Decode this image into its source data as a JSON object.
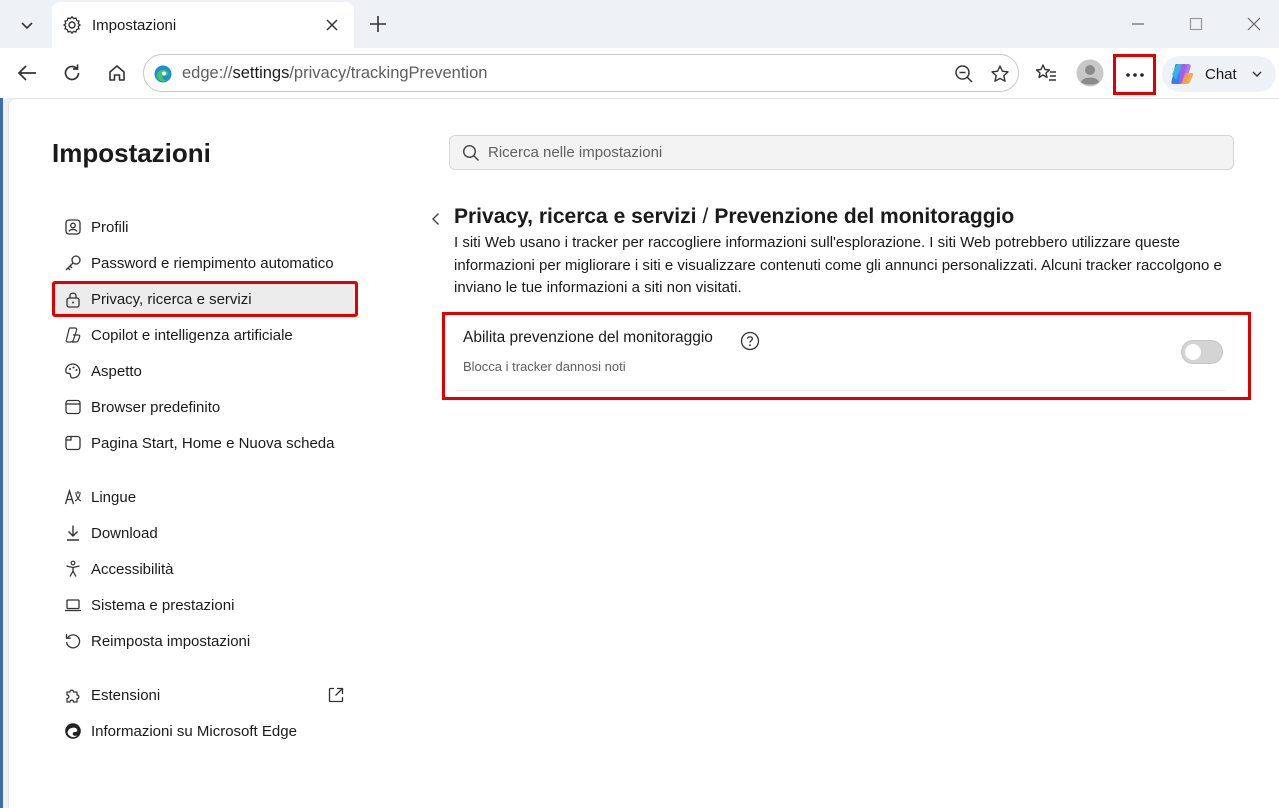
{
  "browser": {
    "tab_title": "Impostazioni",
    "url_prefix": "edge://",
    "url_host": "settings",
    "url_path": "/privacy/trackingPrevention",
    "chat_label": "Chat"
  },
  "settings": {
    "title": "Impostazioni",
    "search_placeholder": "Ricerca nelle impostazioni",
    "nav": [
      {
        "label": "Profili",
        "icon": "profile-icon"
      },
      {
        "label": "Password e riempimento automatico",
        "icon": "key-icon"
      },
      {
        "label": "Privacy, ricerca e servizi",
        "icon": "lock-icon",
        "active": true
      },
      {
        "label": "Copilot e intelligenza artificiale",
        "icon": "copilot-icon"
      },
      {
        "label": "Aspetto",
        "icon": "palette-icon"
      },
      {
        "label": "Browser predefinito",
        "icon": "browser-icon"
      },
      {
        "label": "Pagina Start, Home e Nuova scheda",
        "icon": "newtab-icon"
      },
      {
        "label": "Lingue",
        "icon": "language-icon"
      },
      {
        "label": "Download",
        "icon": "download-icon"
      },
      {
        "label": "Accessibilità",
        "icon": "accessibility-icon"
      },
      {
        "label": "Sistema e prestazioni",
        "icon": "laptop-icon"
      },
      {
        "label": "Reimposta impostazioni",
        "icon": "reset-icon"
      },
      {
        "label": "Estensioni",
        "icon": "puzzle-icon"
      },
      {
        "label": "Informazioni su Microsoft Edge",
        "icon": "edge-icon"
      }
    ]
  },
  "page": {
    "breadcrumb_parent": "Privacy, ricerca e servizi",
    "breadcrumb_separator": "/",
    "breadcrumb_current": "Prevenzione del monitoraggio",
    "description": "I siti Web usano i tracker per raccogliere informazioni sull'esplorazione. I siti Web potrebbero utilizzare queste informazioni per migliorare i siti e visualizzare contenuti come gli annunci personalizzati. Alcuni tracker raccolgono e inviano le tue informazioni a siti non visitati.",
    "setting": {
      "label": "Abilita prevenzione del monitoraggio",
      "sublabel": "Blocca i tracker dannosi noti",
      "enabled": false
    }
  },
  "colors": {
    "highlight": "#e00000",
    "toggle_off": "#d4d4d4"
  }
}
